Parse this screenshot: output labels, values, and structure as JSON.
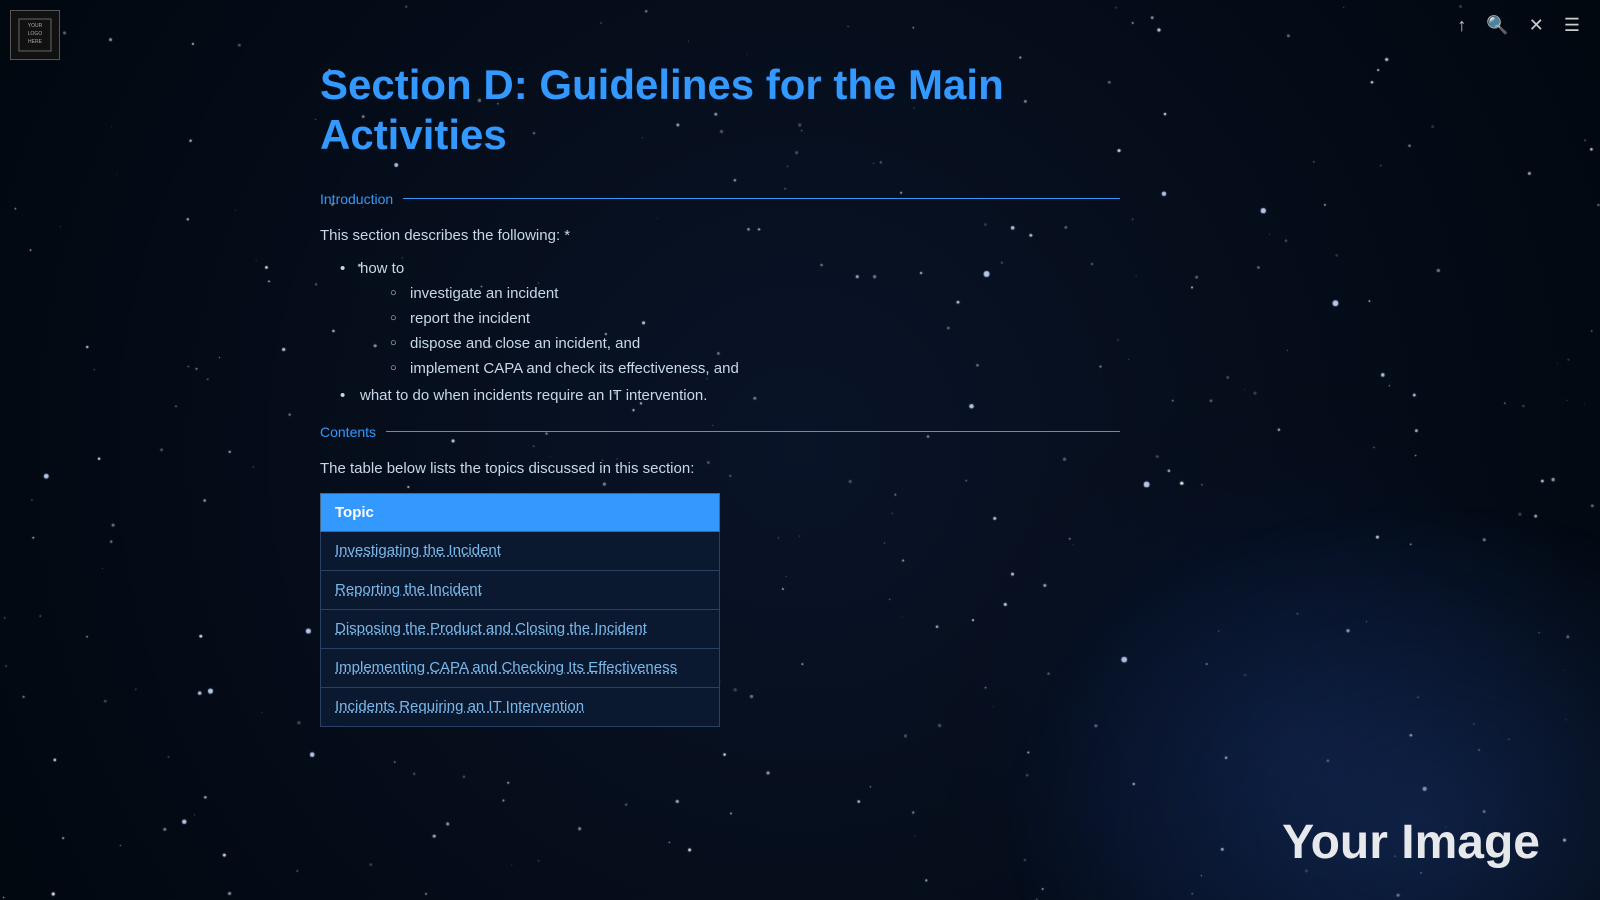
{
  "logo": {
    "line1": "YOUR",
    "line2": "LOGO",
    "line3": "HERE"
  },
  "toolbar": {
    "bookmark_icon": "↑",
    "search_icon": "🔍",
    "close_icon": "✕",
    "menu_icon": "☰"
  },
  "page": {
    "title": "Section D: Guidelines for the Main Activities",
    "introduction_label": "Introduction",
    "intro_text": "This section describes the following:  *",
    "bullets": [
      {
        "text": "how to",
        "sub_items": [
          "investigate an incident",
          "report the incident",
          "dispose and close an incident, and",
          "implement CAPA and check its effectiveness, and"
        ]
      },
      {
        "text": "what to do when incidents require an IT intervention."
      }
    ],
    "contents_label": "Contents",
    "contents_intro": "The table below lists the topics discussed in this section:",
    "table": {
      "header": "Topic",
      "rows": [
        "Investigating the Incident",
        "Reporting the Incident",
        "Disposing the Product and Closing the Incident",
        "Implementing CAPA and Checking Its Effectiveness",
        "Incidents Requiring an IT Intervention"
      ]
    }
  },
  "watermark": {
    "text": "Your Image"
  }
}
